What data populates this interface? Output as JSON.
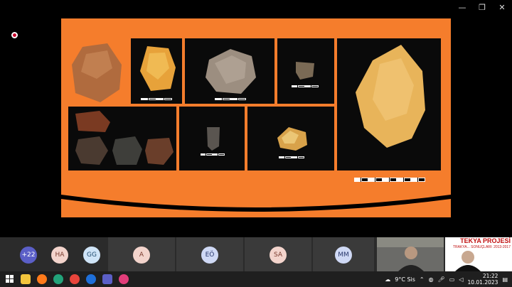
{
  "window": {
    "minimize": "—",
    "maximize": "❐",
    "close": "✕"
  },
  "participants": [
    {
      "initials": "+22",
      "color": "#5b5fc7",
      "text_color": "#ffffff"
    },
    {
      "initials": "HA",
      "color": "#f3d4cc",
      "text_color": "#7a3b2e"
    },
    {
      "initials": "GG",
      "color": "#cfe4f7",
      "text_color": "#1e4a6e"
    },
    {
      "initials": "A",
      "color": "#f3d4cc",
      "text_color": "#7a3b2e"
    },
    {
      "initials": "EÖ",
      "color": "#cfd9f5",
      "text_color": "#27366b"
    },
    {
      "initials": "SA",
      "color": "#f3d4cc",
      "text_color": "#7a3b2e"
    },
    {
      "initials": "MM",
      "color": "#cfd9f5",
      "text_color": "#27366b"
    }
  ],
  "shared_video": {
    "title": "TEKYA PROJESİ",
    "subtitle": "TRAKYA... SONUÇLARI: 2013-2017"
  },
  "taskbar": {
    "weather": "9°C Sis",
    "time": "21:22",
    "date": "10.01.2023"
  }
}
